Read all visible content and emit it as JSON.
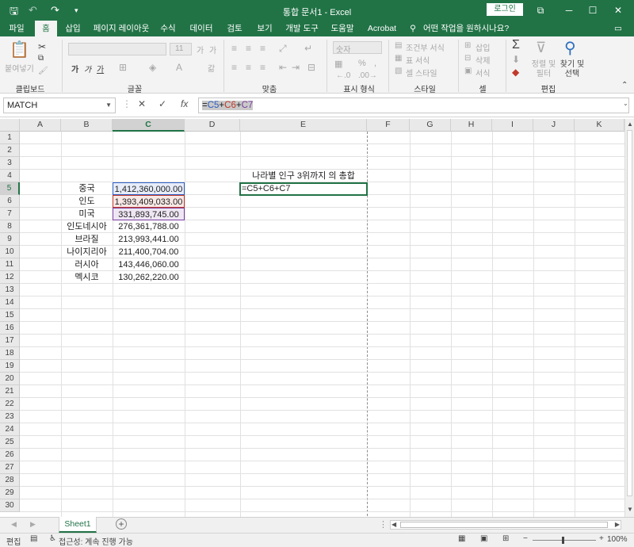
{
  "window": {
    "title": "통합 문서1  -  Excel",
    "login_label": "로그인",
    "qat": {
      "save": "🖫",
      "undo": "↶",
      "redo": "↷",
      "more": "▾"
    },
    "controls": {
      "ribbon_display": "⧉",
      "minimize": "─",
      "maximize": "☐",
      "close": "✕"
    }
  },
  "ribbon_tabs": [
    "파일",
    "홈",
    "삽입",
    "페이지 레이아웃",
    "수식",
    "데이터",
    "검토",
    "보기",
    "개발 도구",
    "도움말",
    "Acrobat"
  ],
  "tell_me": "어떤 작업을 원하시나요?",
  "ribbon": {
    "clipboard": {
      "paste": "붙여넣기",
      "group": "클립보드"
    },
    "font": {
      "size": "11",
      "grow": "가",
      "shrink": "가",
      "bold": "가",
      "italic": "가",
      "underline": "가",
      "group": "글꼴"
    },
    "alignment": {
      "group": "맞춤"
    },
    "number": {
      "format": "숫자",
      "group": "표시 형식"
    },
    "styles": {
      "conditional": "조건부 서식",
      "table": "표 서식",
      "cell": "셀 스타일",
      "group": "스타일"
    },
    "cells": {
      "insert": "삽입",
      "delete": "삭제",
      "format": "서식",
      "group": "셀"
    },
    "editing": {
      "sort_filter": "정렬 및 필터",
      "find_select": "찾기 및 선택",
      "group": "편집"
    }
  },
  "formula_bar": {
    "name_box": "MATCH",
    "cancel": "✕",
    "enter": "✓",
    "fx": "fx",
    "formula_parts": [
      "=",
      "C5",
      "+",
      "C6",
      "+",
      "C7"
    ]
  },
  "columns": [
    "A",
    "B",
    "C",
    "D",
    "E",
    "F",
    "G",
    "H",
    "I",
    "J",
    "K"
  ],
  "rows": [
    "1",
    "2",
    "3",
    "4",
    "5",
    "6",
    "7",
    "8",
    "9",
    "10",
    "11",
    "12",
    "13",
    "14",
    "15",
    "16",
    "17",
    "18",
    "19",
    "20",
    "21",
    "22",
    "23",
    "24",
    "25",
    "26",
    "27",
    "28",
    "29",
    "30"
  ],
  "cells": {
    "E4": "나라별 인구 3위까지 의 총합",
    "E5": "=C5+C6+C7",
    "countries": [
      "중국",
      "인도",
      "미국",
      "인도네시아",
      "브라질",
      "나이지리아",
      "러시아",
      "멕시코"
    ],
    "populations": [
      "1,412,360,000.00",
      "1,393,409,033.00",
      "331,893,745.00",
      "276,361,788.00",
      "213,993,441.00",
      "211,400,704.00",
      "143,446,060.00",
      "130,262,220.00"
    ]
  },
  "sheet_tabs": [
    "Sheet1"
  ],
  "status": {
    "mode": "편집",
    "accessibility": "접근성: 계속 진행 가능",
    "zoom": "100%"
  },
  "colors": {
    "excel_green": "#217346",
    "ref_blue": "#2e5fc4",
    "ref_red": "#c0392b",
    "ref_purple": "#7b3fa0"
  }
}
